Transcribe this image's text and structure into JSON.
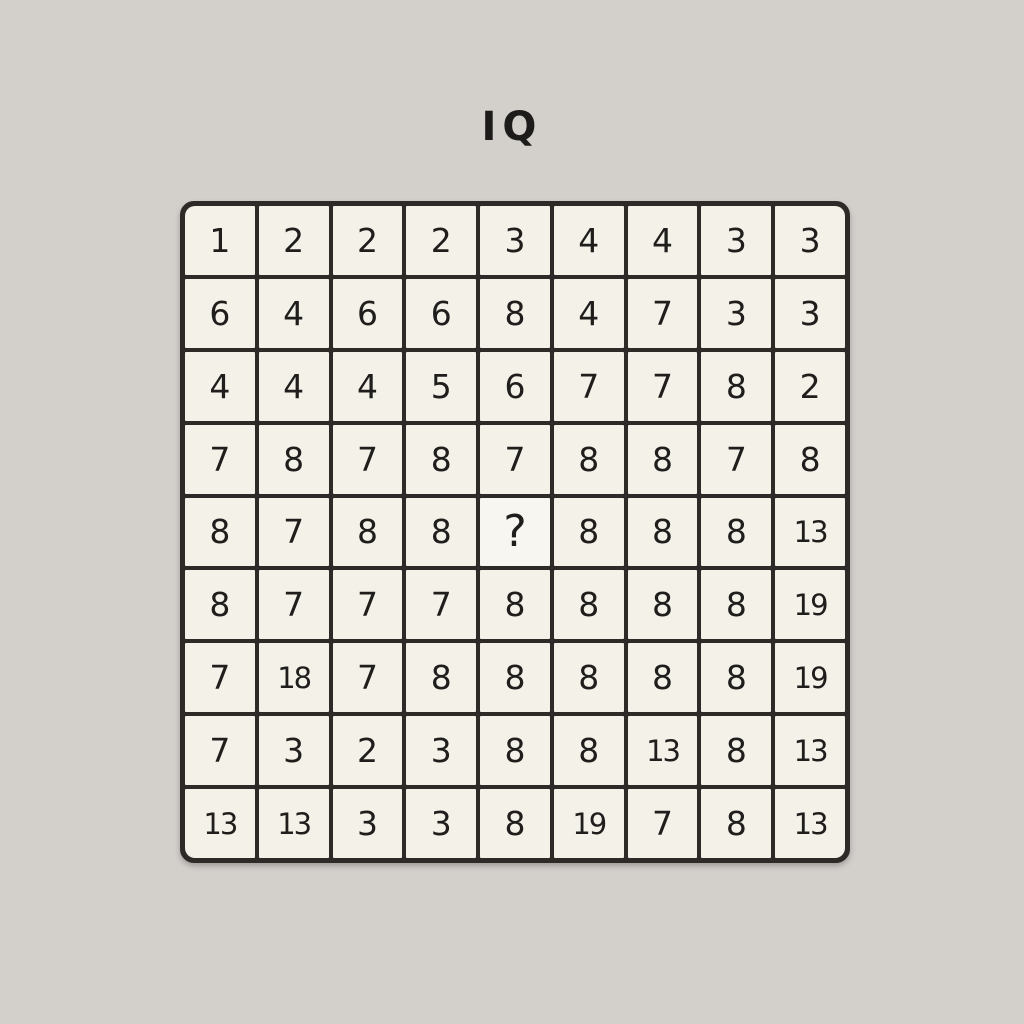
{
  "title": "IQ",
  "grid": [
    [
      "1",
      "2",
      "2",
      "2",
      "3",
      "4",
      "4",
      "3",
      "3"
    ],
    [
      "6",
      "4",
      "6",
      "6",
      "8",
      "4",
      "7",
      "3",
      "3"
    ],
    [
      "4",
      "4",
      "4",
      "5",
      "6",
      "7",
      "7",
      "8",
      "2"
    ],
    [
      "7",
      "8",
      "7",
      "8",
      "7",
      "8",
      "8",
      "7",
      "8"
    ],
    [
      "8",
      "7",
      "8",
      "8",
      "?",
      "8",
      "8",
      "8",
      "13"
    ],
    [
      "8",
      "7",
      "7",
      "7",
      "8",
      "8",
      "8",
      "8",
      "19"
    ],
    [
      "7",
      "18",
      "7",
      "8",
      "8",
      "8",
      "8",
      "8",
      "19"
    ],
    [
      "7",
      "3",
      "2",
      "3",
      "8",
      "8",
      "13",
      "8",
      "13"
    ],
    [
      "13",
      "13",
      "3",
      "3",
      "8",
      "19",
      "7",
      "8",
      "13"
    ]
  ],
  "colors": {
    "background": "#d3d0cc",
    "cell": "#f3f1e8",
    "grid_line": "#2d2a27",
    "text": "#1f1e1c"
  }
}
